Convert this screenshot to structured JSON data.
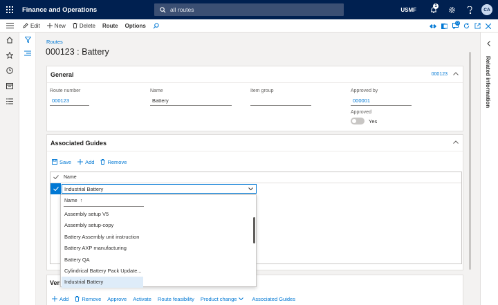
{
  "topbar": {
    "app_title": "Finance and Operations",
    "search_placeholder": "all routes",
    "company": "USMF",
    "notification_count": "1",
    "avatar_initials": "CA"
  },
  "actionbar": {
    "edit": "Edit",
    "new": "New",
    "delete": "Delete",
    "route": "Route",
    "options": "Options",
    "badge_count": "0"
  },
  "page": {
    "breadcrumb": "Routes",
    "title": "000123 : Battery"
  },
  "related_information": "Related information",
  "general": {
    "header": "General",
    "summary": "000123",
    "route_number_label": "Route number",
    "route_number_value": "000123",
    "name_label": "Name",
    "name_value": "Battery",
    "item_group_label": "Item group",
    "item_group_value": "",
    "approved_by_label": "Approved by",
    "approved_by_value": "000001",
    "approved_label": "Approved",
    "approved_value": "Yes"
  },
  "associated_guides": {
    "header": "Associated Guides",
    "save": "Save",
    "add": "Add",
    "remove": "Remove",
    "column_name": "Name",
    "selected_value": "Industrial Battery",
    "dropdown_header": "Name",
    "dropdown_sort_glyph": "↑",
    "options": [
      "Assembly setup V5",
      "Assembly setup-copy",
      "Battery Assembly unit instruction",
      "Battery AXP manufacturing",
      "Battery QA",
      "Cylindrical Battery Pack Update...",
      "Industrial Battery"
    ]
  },
  "versions": {
    "header": "Vers",
    "add": "Add",
    "remove": "Remove",
    "approve": "Approve",
    "activate": "Activate",
    "route_feasibility": "Route feasibility",
    "product_change": "Product change",
    "associated_guides": "Associated Guides"
  },
  "colors": {
    "topbar": "#002050",
    "accent": "#0078d4"
  }
}
